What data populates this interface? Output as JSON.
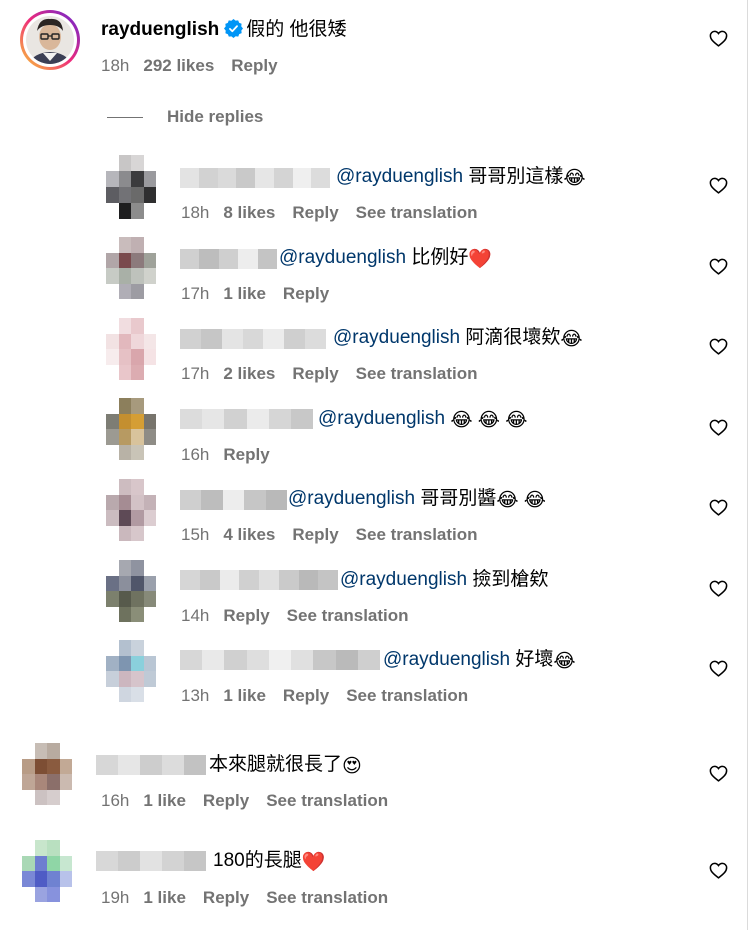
{
  "main_comment": {
    "username": "rayduenglish",
    "text": "假的 他很矮",
    "time": "18h",
    "likes": "292 likes",
    "reply": "Reply"
  },
  "hide_replies": "Hide replies",
  "replies": [
    {
      "mention": "@rayduenglish",
      "text": "哥哥別這樣",
      "emoji": "😂",
      "time": "18h",
      "likes": "8 likes",
      "reply": "Reply",
      "translate": "See translation"
    },
    {
      "mention": "@rayduenglish",
      "text": "比例好",
      "emoji": "❤️",
      "time": "17h",
      "likes": "1 like",
      "reply": "Reply",
      "translate": ""
    },
    {
      "mention": "@rayduenglish",
      "text": "阿滴很壞欸",
      "emoji": "😂",
      "time": "17h",
      "likes": "2 likes",
      "reply": "Reply",
      "translate": "See translation"
    },
    {
      "mention": "@rayduenglish",
      "text": "",
      "emoji": "😂 😂 😂",
      "time": "16h",
      "likes": "",
      "reply": "Reply",
      "translate": ""
    },
    {
      "mention": "@rayduenglish",
      "text": "哥哥別醬",
      "emoji": "😂 😂",
      "time": "15h",
      "likes": "4 likes",
      "reply": "Reply",
      "translate": "See translation"
    },
    {
      "mention": "@rayduenglish",
      "text": "撿到槍欸",
      "emoji": "",
      "time": "14h",
      "likes": "",
      "reply": "Reply",
      "translate": "See translation"
    },
    {
      "mention": "@rayduenglish",
      "text": "好壞",
      "emoji": "😂",
      "time": "13h",
      "likes": "1 like",
      "reply": "Reply",
      "translate": "See translation"
    }
  ],
  "comments": [
    {
      "text": "本來腿就很長了",
      "emoji": "😍",
      "time": "16h",
      "likes": "1 like",
      "reply": "Reply",
      "translate": "See translation"
    },
    {
      "text": "180的長腿",
      "emoji": "❤️",
      "time": "19h",
      "likes": "1 like",
      "reply": "Reply",
      "translate": "See translation"
    }
  ],
  "colors": {
    "mention": "#00376b",
    "meta": "#737373",
    "verified": "#0095f6",
    "ring_start": "#f9ce34",
    "ring_mid": "#ee2a7b",
    "ring_end": "#6228d7"
  }
}
